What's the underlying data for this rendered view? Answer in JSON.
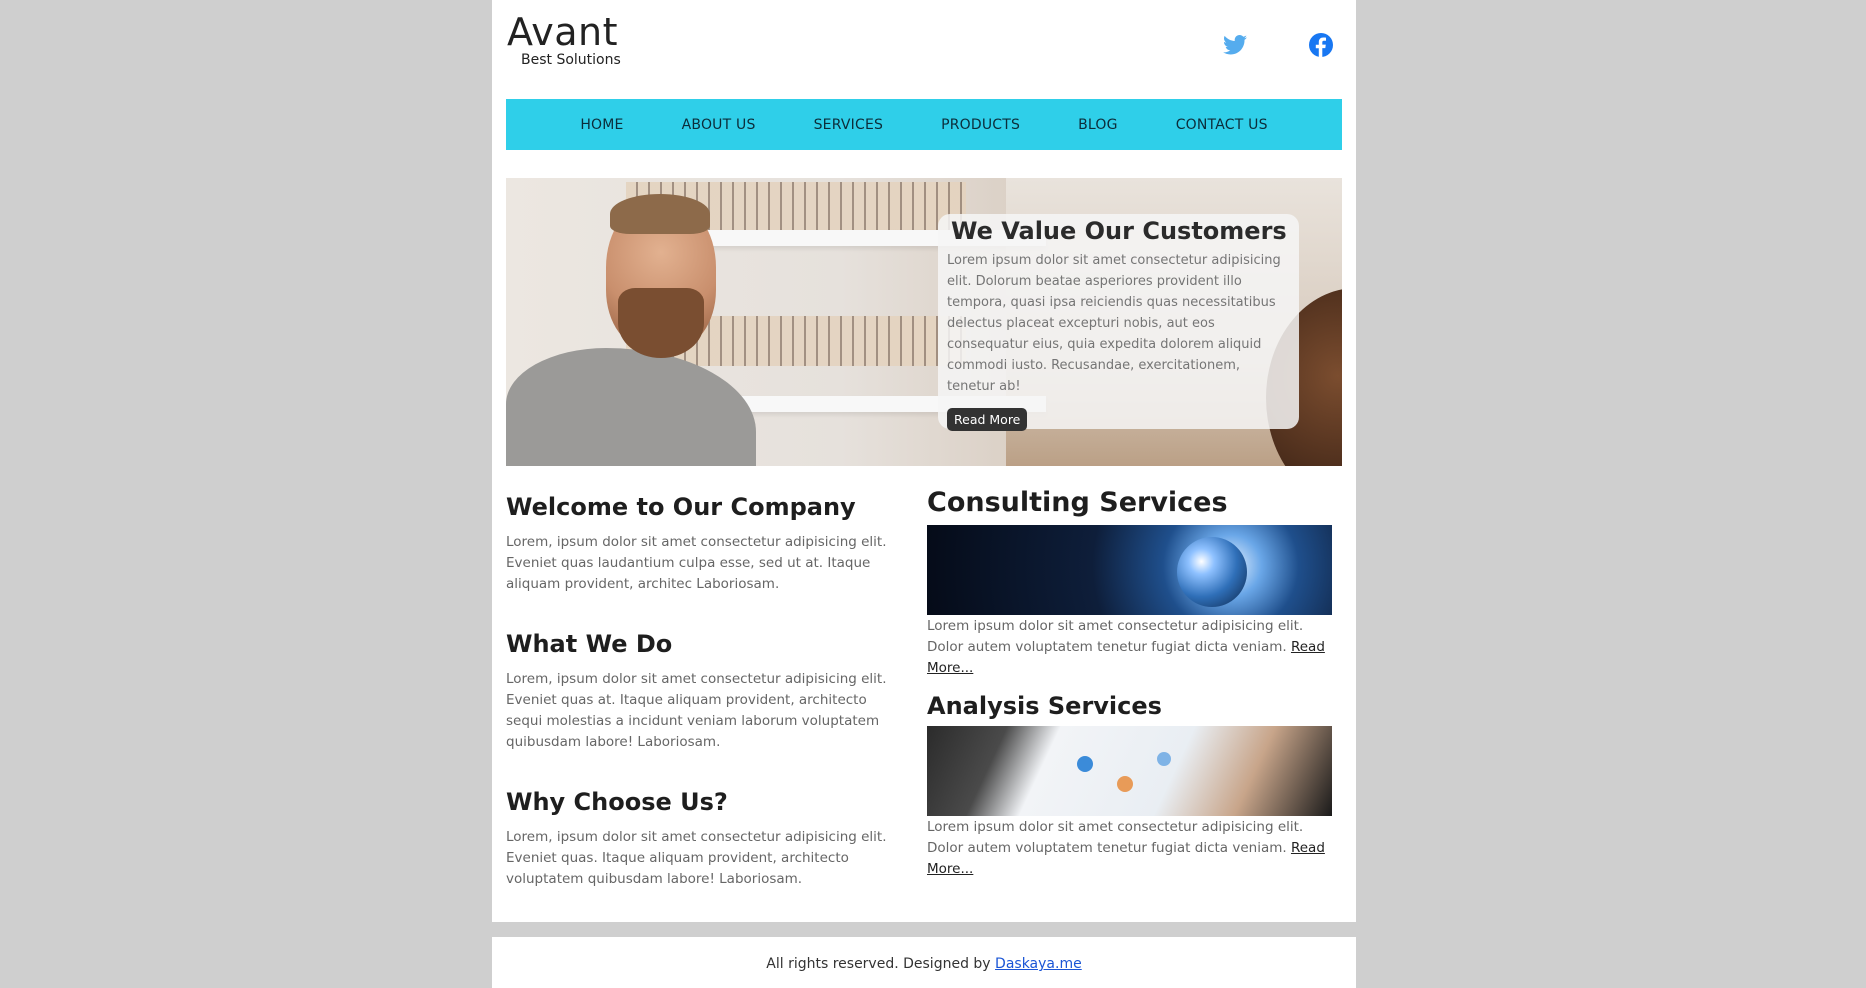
{
  "header": {
    "brand_name": "Avant",
    "brand_tagline": "Best Solutions"
  },
  "social": {
    "twitter_icon": "twitter-icon",
    "facebook_icon": "facebook-icon",
    "twitter_color": "#55acee",
    "facebook_color": "#1877f2"
  },
  "nav": {
    "items": [
      {
        "label": "HOME"
      },
      {
        "label": "ABOUT US"
      },
      {
        "label": "SERVICES"
      },
      {
        "label": "PRODUCTS"
      },
      {
        "label": "BLOG"
      },
      {
        "label": "CONTACT US"
      }
    ],
    "background": "#2fcfe9"
  },
  "hero": {
    "title": "We Value Our Customers",
    "text": "Lorem ipsum dolor sit amet consectetur adipisicing elit. Dolorum beatae asperiores provident illo tempora, quasi ipsa reiciendis quas necessitatibus delectus placeat excepturi nobis, aut eos consequatur eius, quia expedita dolorem aliquid commodi iusto. Recusandae, exercitationem, tenetur ab!",
    "button_label": "Read More"
  },
  "left": {
    "sections": [
      {
        "title": "Welcome to Our Company",
        "text": "Lorem, ipsum dolor sit amet consectetur adipisicing elit. Eveniet quas laudantium culpa esse, sed ut at. Itaque aliquam provident, architec Laboriosam."
      },
      {
        "title": "What We Do",
        "text": "Lorem, ipsum dolor sit amet consectetur adipisicing elit. Eveniet quas at. Itaque aliquam provident, architecto sequi molestias a incidunt veniam laborum voluptatem quibusdam labore! Laboriosam."
      },
      {
        "title": "Why Choose Us?",
        "text": "Lorem, ipsum dolor sit amet consectetur adipisicing elit. Eveniet quas. Itaque aliquam provident, architecto voluptatem quibusdam labore! Laboriosam."
      }
    ]
  },
  "right": {
    "services": [
      {
        "title": "Consulting Services",
        "text": "Lorem ipsum dolor sit amet consectetur adipisicing elit. Dolor autem voluptatem tenetur fugiat dicta veniam.",
        "link": "Read More..."
      },
      {
        "title": "Analysis Services",
        "text": "Lorem ipsum dolor sit amet consectetur adipisicing elit. Dolor autem voluptatem tenetur fugiat dicta veniam.",
        "link": "Read More..."
      }
    ]
  },
  "footer": {
    "text": "All rights reserved. Designed by",
    "link": "Daskaya.me"
  }
}
